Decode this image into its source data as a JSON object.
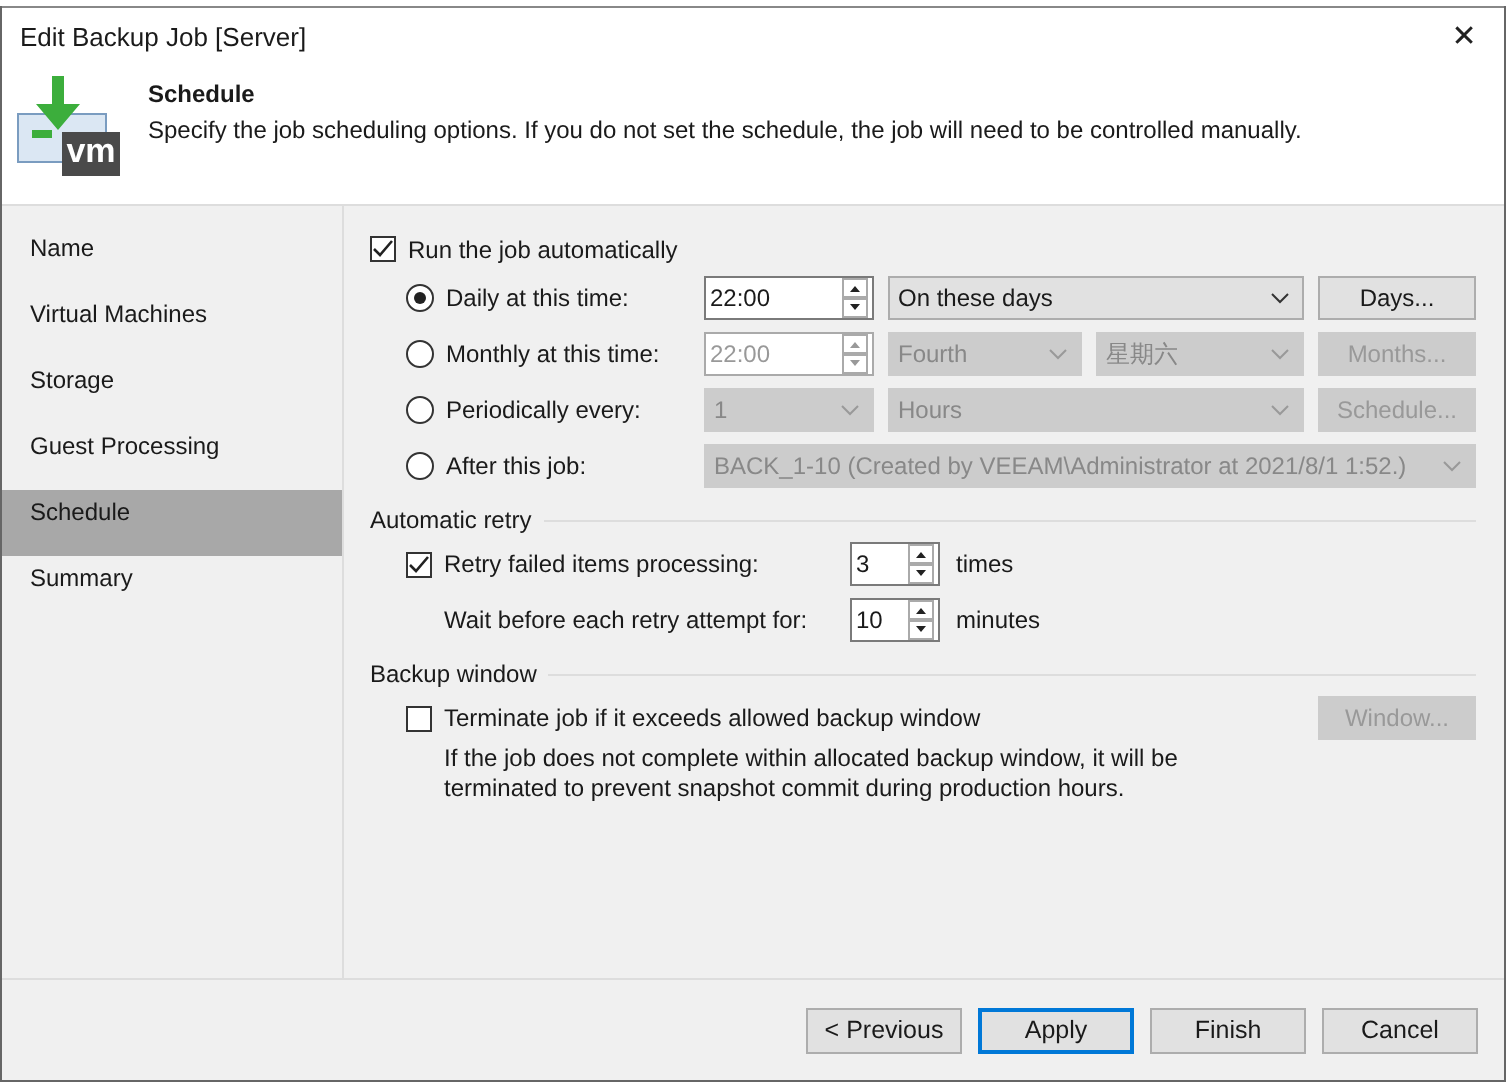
{
  "window": {
    "title": "Edit Backup Job [Server]",
    "close": "✕"
  },
  "header": {
    "logo_text": "vm",
    "title": "Schedule",
    "description": "Specify the job scheduling options. If you do not set the schedule, the job will need to be controlled manually."
  },
  "sidebar": {
    "items": [
      {
        "label": "Name",
        "selected": false
      },
      {
        "label": "Virtual Machines",
        "selected": false
      },
      {
        "label": "Storage",
        "selected": false
      },
      {
        "label": "Guest Processing",
        "selected": false
      },
      {
        "label": "Schedule",
        "selected": true
      },
      {
        "label": "Summary",
        "selected": false
      }
    ]
  },
  "schedule": {
    "run_automatically": {
      "label": "Run the job automatically",
      "checked": true
    },
    "options": [
      {
        "kind": "daily",
        "label": "Daily at this time:",
        "selected": true,
        "time": "22:00",
        "days": "On these days",
        "button": "Days..."
      },
      {
        "kind": "monthly",
        "label": "Monthly at this time:",
        "selected": false,
        "time": "22:00",
        "week": "Fourth",
        "day": "星期六",
        "button": "Months..."
      },
      {
        "kind": "periodic",
        "label": "Periodically every:",
        "selected": false,
        "value": "1",
        "unit": "Hours",
        "button": "Schedule..."
      },
      {
        "kind": "after",
        "label": "After this job:",
        "selected": false,
        "job": "BACK_1-10 (Created by VEEAM\\Administrator at 2021/8/1 1:52.)"
      }
    ]
  },
  "automatic_retry": {
    "title": "Automatic retry",
    "retry": {
      "label": "Retry failed items processing:",
      "checked": true,
      "value": "3",
      "unit": "times"
    },
    "wait": {
      "label": "Wait before each retry attempt for:",
      "value": "10",
      "unit": "minutes"
    }
  },
  "backup_window": {
    "title": "Backup window",
    "terminate": {
      "label": "Terminate job if it exceeds allowed backup window",
      "checked": false
    },
    "button": "Window...",
    "description": "If the job does not complete within allocated backup window, it will be terminated to prevent snapshot commit during production hours."
  },
  "buttons": [
    {
      "label": "< Previous",
      "focused": false
    },
    {
      "label": "Apply",
      "focused": true
    },
    {
      "label": "Finish",
      "focused": false
    },
    {
      "label": "Cancel",
      "focused": false
    }
  ]
}
